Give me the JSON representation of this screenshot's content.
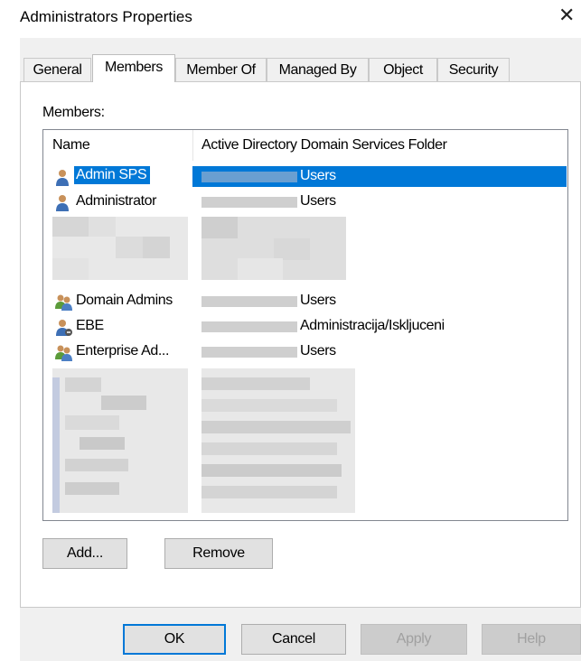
{
  "window": {
    "title": "Administrators Properties"
  },
  "tabs": [
    {
      "label": "General",
      "active": false
    },
    {
      "label": "Members",
      "active": true
    },
    {
      "label": "Member Of",
      "active": false
    },
    {
      "label": "Managed By",
      "active": false
    },
    {
      "label": "Object",
      "active": false
    },
    {
      "label": "Security",
      "active": false
    }
  ],
  "members_label": "Members:",
  "columns": {
    "name": "Name",
    "folder": "Active Directory Domain Services Folder"
  },
  "members": [
    {
      "name": "Admin SPS",
      "folder": "Users",
      "icon": "user-icon",
      "selected": true
    },
    {
      "name": "Administrator",
      "folder": "Users",
      "icon": "user-icon",
      "selected": false
    },
    {
      "name": "Domain Admins",
      "folder": "Users",
      "icon": "group-icon",
      "selected": false
    },
    {
      "name": "EBE",
      "folder": "Administracija/Iskljuceni",
      "icon": "disabled-user-icon",
      "selected": false
    },
    {
      "name": "Enterprise Ad...",
      "folder": "Users",
      "icon": "group-icon",
      "selected": false
    }
  ],
  "buttons": {
    "add": "Add...",
    "remove": "Remove",
    "ok": "OK",
    "cancel": "Cancel",
    "apply": "Apply",
    "help": "Help"
  },
  "colors": {
    "selection": "#0078d7",
    "dialog_bg": "#f0f0f0"
  }
}
